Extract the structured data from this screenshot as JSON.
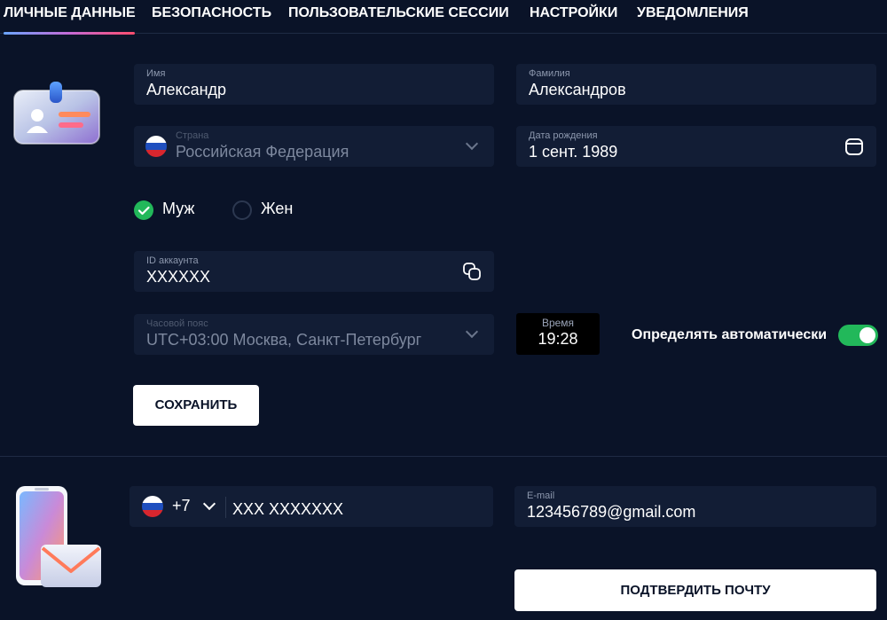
{
  "tabs": [
    {
      "label": "ЛИЧНЫЕ ДАННЫЕ",
      "active": true
    },
    {
      "label": "БЕЗОПАСНОСТЬ"
    },
    {
      "label": "ПОЛЬЗОВАТЕЛЬСКИЕ СЕССИИ"
    },
    {
      "label": "НАСТРОЙКИ"
    },
    {
      "label": "УВЕДОМЛЕНИЯ"
    }
  ],
  "personal": {
    "first_name": {
      "label": "Имя",
      "value": "Александр"
    },
    "last_name": {
      "label": "Фамилия",
      "value": "Александров"
    },
    "country": {
      "label": "Страна",
      "value": "Российская Федерация",
      "flag": "russia-flag-icon"
    },
    "birthdate": {
      "label": "Дата рождения",
      "value": "1 сент. 1989"
    },
    "gender": {
      "male": "Муж",
      "female": "Жен",
      "selected": "male"
    },
    "account_id": {
      "label": "ID аккаунта",
      "value": "XXXXXX"
    },
    "timezone": {
      "label": "Часовой пояс",
      "value": "UTC+03:00 Москва, Санкт-Петербург"
    },
    "time": {
      "label": "Время",
      "value": "19:28"
    },
    "auto_detect": {
      "label": "Определять автоматически",
      "enabled": true
    },
    "save_label": "СОХРАНИТЬ"
  },
  "contacts": {
    "phone": {
      "code": "+7",
      "value": "XXX XXXXXXX",
      "flag": "russia-flag-icon"
    },
    "email": {
      "label": "E-mail",
      "value": "123456789@gmail.com"
    },
    "confirm_label": "ПОДТВЕРДИТЬ ПОЧТУ"
  },
  "colors": {
    "background": "#0a1328",
    "field": "#121d35",
    "accent_green": "#22b85a",
    "tab_gradient": [
      "#6aa6ff",
      "#c46ad6",
      "#ff4d6d"
    ]
  }
}
